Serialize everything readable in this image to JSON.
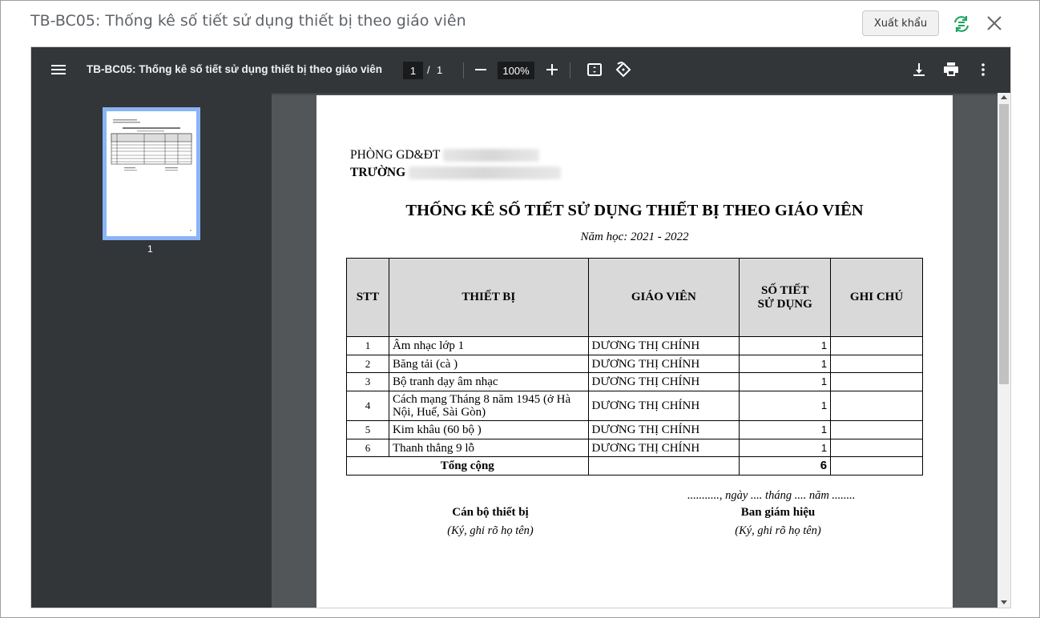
{
  "dialog": {
    "title": "TB-BC05: Thống kê số tiết sử dụng thiết bị theo giáo viên",
    "export_label": "Xuất khẩu"
  },
  "toolbar": {
    "doc_title": "TB-BC05: Thống kê số tiết sử dụng thiết bị theo giáo viên",
    "page_current": "1",
    "page_separator": "/",
    "page_total": "1",
    "zoom": "100%"
  },
  "sidebar": {
    "thumb_label": "1"
  },
  "report": {
    "org_line1": "PHÒNG GD&ĐT",
    "org_line2": "TRƯỜNG",
    "title": "THỐNG KÊ SỐ TIẾT SỬ DỤNG THIẾT BỊ THEO GIÁO VIÊN",
    "subtitle": "Năm học: 2021 - 2022",
    "headers": {
      "stt": "STT",
      "device": "THIẾT BỊ",
      "teacher": "GIÁO VIÊN",
      "periods_line1": "SỐ TIẾT",
      "periods_line2": "SỬ DỤNG",
      "note": "GHI CHÚ"
    },
    "rows": [
      {
        "stt": "1",
        "device": "Âm nhạc lớp 1",
        "teacher": "DƯƠNG THỊ CHÍNH",
        "periods": "1",
        "note": ""
      },
      {
        "stt": "2",
        "device": "Băng tải (cà )",
        "teacher": "DƯƠNG THỊ CHÍNH",
        "periods": "1",
        "note": ""
      },
      {
        "stt": "3",
        "device": "Bộ tranh dạy âm nhạc",
        "teacher": "DƯƠNG THỊ CHÍNH",
        "periods": "1",
        "note": ""
      },
      {
        "stt": "4",
        "device": "Cách mạng Tháng 8 năm 1945 (ở Hà Nội, Huế, Sài Gòn)",
        "teacher": "DƯƠNG THỊ CHÍNH",
        "periods": "1",
        "note": ""
      },
      {
        "stt": "5",
        "device": "Kim khâu (60 bộ )",
        "teacher": "DƯƠNG THỊ CHÍNH",
        "periods": "1",
        "note": ""
      },
      {
        "stt": "6",
        "device": "Thanh thẳng 9 lỗ",
        "teacher": "DƯƠNG THỊ CHÍNH",
        "periods": "1",
        "note": ""
      }
    ],
    "total_label": "Tổng cộng",
    "total_value": "6",
    "date_line": "..........., ngày .... tháng .... năm ........",
    "sig_left_title": "Cán bộ thiết bị",
    "sig_left_note": "(Ký, ghi rõ họ tên)",
    "sig_right_title": "Ban giám hiệu",
    "sig_right_note": "(Ký, ghi rõ họ tên)"
  },
  "colors": {
    "toolbar_bg": "#323639",
    "viewer_bg": "#525659",
    "thumb_border": "#8ab4f8",
    "sync_icon": "#1fa463",
    "header_cell_bg": "#d9d9d9"
  },
  "icons": [
    "menu-icon",
    "zoom-out-icon",
    "zoom-in-icon",
    "fit-page-icon",
    "rotate-icon",
    "download-icon",
    "print-icon",
    "more-vert-icon",
    "sync-icon",
    "close-icon"
  ]
}
